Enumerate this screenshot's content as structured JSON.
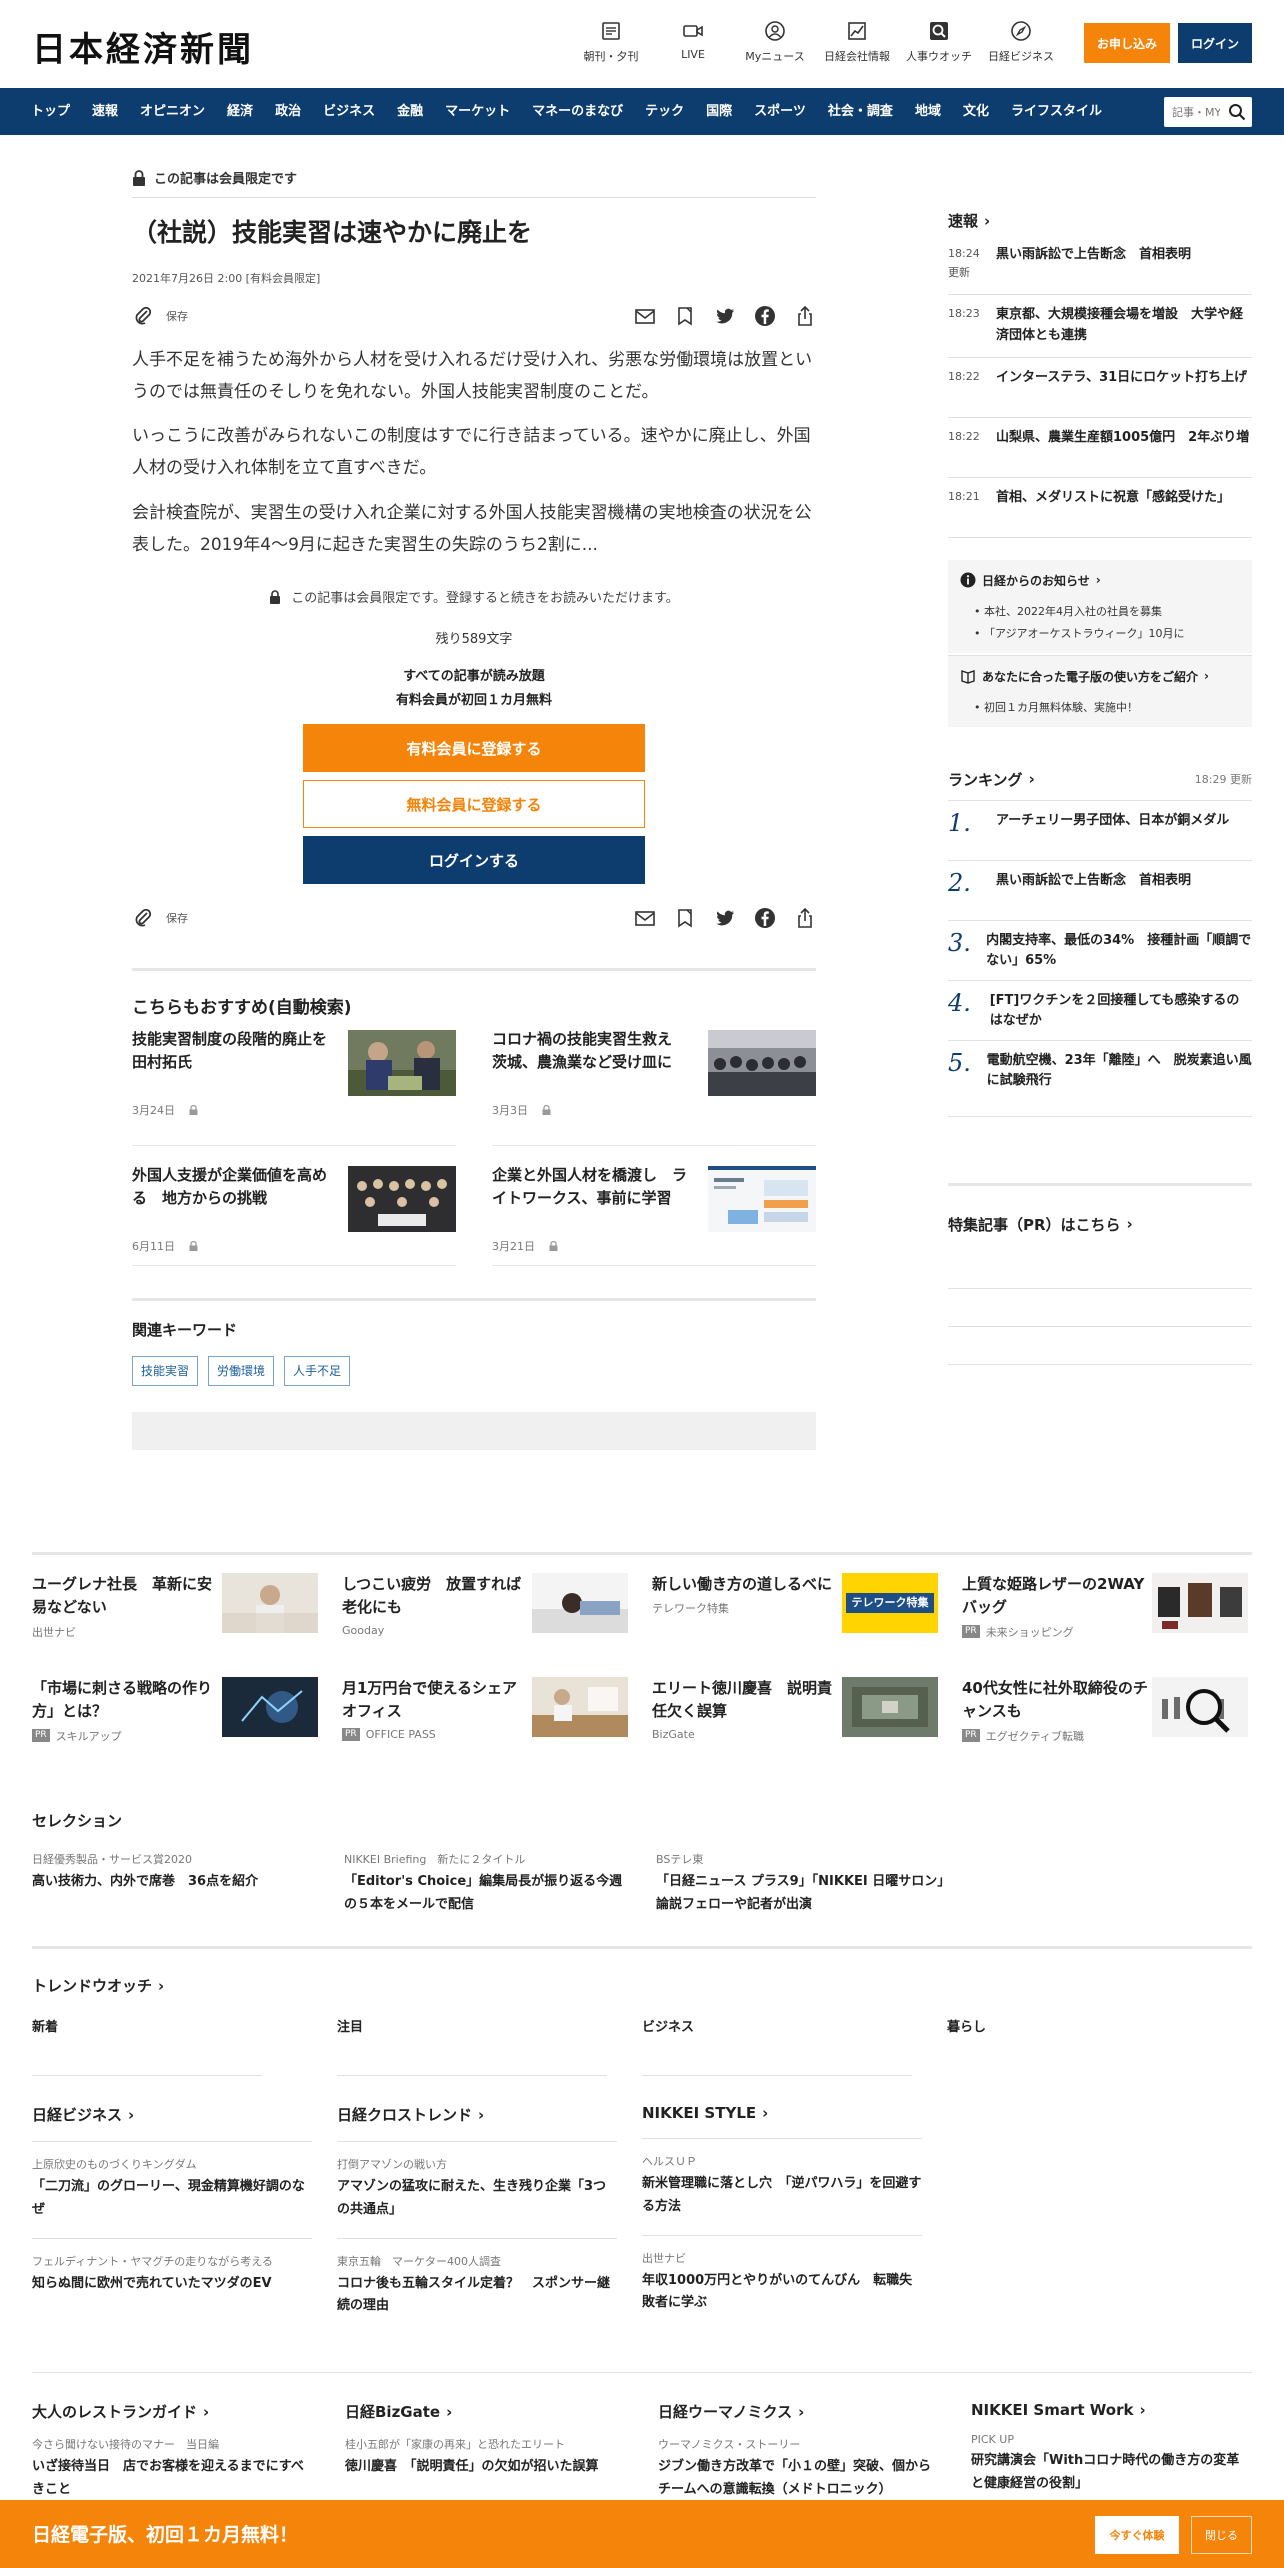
{
  "header": {
    "logo": "日本経済新聞",
    "nav": [
      {
        "label": "朝刊・夕刊",
        "icon": "newspaper-icon"
      },
      {
        "label": "LIVE",
        "icon": "video-camera-icon"
      },
      {
        "label": "Myニュース",
        "icon": "user-icon"
      },
      {
        "label": "日経会社情報",
        "icon": "chart-icon"
      },
      {
        "label": "人事ウオッチ",
        "icon": "person-search-icon"
      },
      {
        "label": "日経ビジネス",
        "icon": "compass-icon"
      }
    ],
    "apply_label": "お申し込み",
    "login_label": "ログイン"
  },
  "navbar": {
    "items": [
      "トップ",
      "速報",
      "オピニオン",
      "経済",
      "政治",
      "ビジネス",
      "金融",
      "マーケット",
      "マネーのまなび",
      "テック",
      "国際",
      "スポーツ",
      "社会・調査",
      "地域",
      "文化",
      "ライフスタイル"
    ],
    "search_placeholder": "記事・MY"
  },
  "article": {
    "members_only": "この記事は会員限定です",
    "title": "（社説）技能実習は速やかに廃止を",
    "date": "2021年7月26日 2:00 [有料会員限定]",
    "save_label": "保存",
    "paragraphs": [
      "人手不足を補うため海外から人材を受け入れるだけ受け入れ、劣悪な労働環境は放置というのでは無責任のそしりを免れない。外国人技能実習制度のことだ。",
      "いっこうに改善がみられないこの制度はすでに行き詰まっている。速やかに廃止し、外国人材の受け入れ体制を立て直すべきだ。",
      "会計検査院が、実習生の受け入れ企業に対する外国人技能実習機構の実地検査の状況を公表した。2019年4～9月に起きた実習生の失踪のうち2割に..."
    ],
    "locked_note": "この記事は会員限定です。登録すると続きをお読みいただけます。",
    "remaining": "残り589文字",
    "promo_line1": "すべての記事が読み放題",
    "promo_line2": "有料会員が初回１カ月無料",
    "cta_paid": "有料会員に登録する",
    "cta_free": "無料会員に登録する",
    "cta_login": "ログインする"
  },
  "recommend": {
    "heading": "こちらもおすすめ(自動検索)",
    "items": [
      {
        "title": "技能実習制度の段階的廃止を　田村拓氏",
        "date": "3月24日"
      },
      {
        "title": "コロナ禍の技能実習生救え　茨城、農漁業など受け皿に",
        "date": "3月3日"
      },
      {
        "title": "外国人支援が企業価値を高める　地方からの挑戦",
        "date": "6月11日"
      },
      {
        "title": "企業と外国人材を橋渡し　ライトワークス、事前に学習",
        "date": "3月21日"
      }
    ]
  },
  "keywords": {
    "heading": "関連キーワード",
    "items": [
      "技能実習",
      "労働環境",
      "人手不足"
    ]
  },
  "sidebar": {
    "sokuhou_heading": "速報",
    "sokuhou": [
      {
        "time": "18:24",
        "sub": "更新",
        "title": "黒い雨訴訟で上告断念　首相表明"
      },
      {
        "time": "18:23",
        "sub": "",
        "title": "東京都、大規模接種会場を増設　大学や経済団体とも連携"
      },
      {
        "time": "18:22",
        "sub": "",
        "title": "インターステラ、31日にロケット打ち上げ"
      },
      {
        "time": "18:22",
        "sub": "",
        "title": "山梨県、農業生産額1005億円　2年ぶり増"
      },
      {
        "time": "18:21",
        "sub": "",
        "title": "首相、メダリストに祝意「感銘受けた」"
      }
    ],
    "notice_heading": "日経からのお知らせ",
    "notices": [
      "本社、2022年4月入社の社員を募集",
      "「アジアオーケストラウィーク」10月に"
    ],
    "guide_heading": "あなたに合った電子版の使い方をご紹介",
    "guides": [
      "初回１カ月無料体験、実施中！"
    ],
    "ranking_heading": "ランキング",
    "ranking_updated": "18:29  更新",
    "ranking": [
      {
        "rank": "1.",
        "title": "アーチェリー男子団体、日本が銅メダル"
      },
      {
        "rank": "2.",
        "title": "黒い雨訴訟で上告断念　首相表明"
      },
      {
        "rank": "3.",
        "title": "内閣支持率、最低の34%　接種計画「順調でない」65%"
      },
      {
        "rank": "4.",
        "title": "[FT]ワクチンを２回接種しても感染するのはなぜか"
      },
      {
        "rank": "5.",
        "title": "電動航空機、23年「離陸」へ　脱炭素追い風に試験飛行"
      }
    ],
    "pr_heading": "特集記事（PR）はこちら"
  },
  "ads": {
    "row1": [
      {
        "title": "ユーグレナ社長　革新に安易などない",
        "source": "出世ナビ",
        "pr": false
      },
      {
        "title": "しつこい疲労　放置すれば老化にも",
        "source": "Gooday",
        "pr": false
      },
      {
        "title": "新しい働き方の道しるべに",
        "source": "テレワーク特集",
        "pr": false
      },
      {
        "title": "上質な姫路レザーの2WAYバッグ",
        "source": "未来ショッピング",
        "pr": true
      }
    ],
    "row2": [
      {
        "title": "「市場に刺さる戦略の作り方」とは？",
        "source": "スキルアップ",
        "pr": true
      },
      {
        "title": "月1万円台で使えるシェアオフィス",
        "source": "OFFICE PASS",
        "pr": true
      },
      {
        "title": "エリート徳川慶喜　説明責任欠く誤算",
        "source": "BizGate",
        "pr": false
      },
      {
        "title": "40代女性に社外取締役のチャンスも",
        "source": "エグゼクティブ転職",
        "pr": true
      }
    ],
    "pr_badge": "PR",
    "telework_banner_text": "テレワーク特集"
  },
  "selection": {
    "heading": "セレクション",
    "items": [
      {
        "kicker": "日経優秀製品・サービス賞2020",
        "title": "高い技術力、内外で席巻　36点を紹介"
      },
      {
        "kicker": "NIKKEI Briefing　新たに２タイトル",
        "title": "「Editor's Choice」編集局長が振り返る今週の５本をメールで配信"
      },
      {
        "kicker": "BSテレ東",
        "title": "「日経ニュース プラス9」「NIKKEI 日曜サロン」論説フェローや記者が出演"
      }
    ]
  },
  "trend": {
    "heading": "トレンドウオッチ",
    "cols": [
      "新着",
      "注目",
      "ビジネス",
      "暮らし"
    ]
  },
  "media1": [
    {
      "name": "日経ビジネス",
      "items": [
        {
          "kicker": "上原欣史のものづくりキングダム",
          "title": "「二刀流」のグローリー、現金精算機好調のなぜ"
        },
        {
          "kicker": "フェルディナント・ヤマグチの走りながら考える",
          "title": "知らぬ間に欧州で売れていたマツダのEV"
        }
      ]
    },
    {
      "name": "日経クロストレンド",
      "items": [
        {
          "kicker": "打倒アマゾンの戦い方",
          "title": "アマゾンの猛攻に耐えた、生き残り企業「3つの共通点」"
        },
        {
          "kicker": "東京五輪　マーケター400人調査",
          "title": "コロナ後も五輪スタイル定着？　スポンサー継続の理由"
        }
      ]
    },
    {
      "name": "NIKKEI STYLE",
      "items": [
        {
          "kicker": "ヘルスＵＰ",
          "title": "新米管理職に落とし穴　「逆パワハラ」を回避する方法"
        },
        {
          "kicker": "出世ナビ",
          "title": "年収1000万円とやりがいのてんびん　転職失敗者に学ぶ"
        }
      ]
    }
  ],
  "media2": [
    {
      "name": "大人のレストランガイド",
      "kicker": "今さら聞けない接待のマナー　当日編",
      "title": "いざ接待当日　店でお客様を迎えるまでにすべきこと"
    },
    {
      "name": "日経BizGate",
      "kicker": "桂小五郎が「家康の再来」と恐れたエリート",
      "title": "徳川慶喜　「説明責任」の欠如が招いた誤算"
    },
    {
      "name": "日経ウーマノミクス",
      "kicker": "ウーマノミクス・ストーリー",
      "title": "ジブン働き方改革で「小１の壁」突破、個からチームへの意識転換（メドトロニック）"
    },
    {
      "name": "NIKKEI Smart Work",
      "kicker": "PICK UP",
      "title": "研究講演会「Withコロナ時代の働き方の変革と健康経営の役割」"
    }
  ],
  "banner": {
    "text": "日経電子版、初回１カ月無料！",
    "try_label": "今すぐ体験",
    "close_label": "閉じる"
  }
}
